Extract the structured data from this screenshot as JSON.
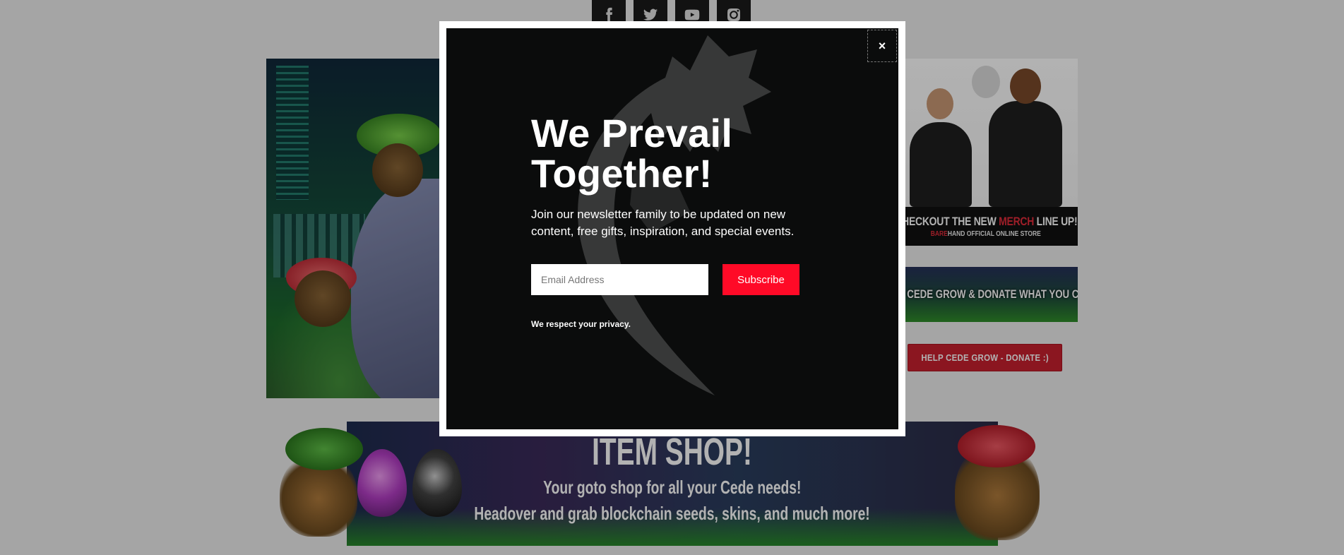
{
  "social": {
    "items": [
      {
        "icon": "facebook-icon"
      },
      {
        "icon": "twitter-icon"
      },
      {
        "icon": "youtube-icon"
      },
      {
        "icon": "instagram-icon"
      }
    ]
  },
  "sidebar": {
    "merch_line1_a": "CHECKOUT THE NEW ",
    "merch_line1_accent": "MERCH",
    "merch_line1_b": " LINE UP!",
    "merch_line2_accent": "BARE",
    "merch_line2_b": "HAND OFFICIAL ONLINE STORE",
    "donate_banner": "HELP CEDE GROW & DONATE WHAT YOU CAN",
    "donate_button": "HELP CEDE GROW - DONATE :)"
  },
  "shop_banner": {
    "title": "ITEM SHOP!",
    "line1": "Your goto shop for all your Cede needs!",
    "line2": "Headover and grab blockchain seeds, skins, and much more!"
  },
  "modal": {
    "close_label": "×",
    "title_line1": "We Prevail",
    "title_line2": "Together!",
    "description": "Join our newsletter family to be updated on new content, free gifts, inspiration, and special events.",
    "email_placeholder": "Email Address",
    "subscribe_label": "Subscribe",
    "privacy_note": "We respect your privacy."
  },
  "colors": {
    "accent_red": "#ff0a27",
    "donate_red": "#c8202f",
    "modal_bg": "#0b0c0c"
  }
}
